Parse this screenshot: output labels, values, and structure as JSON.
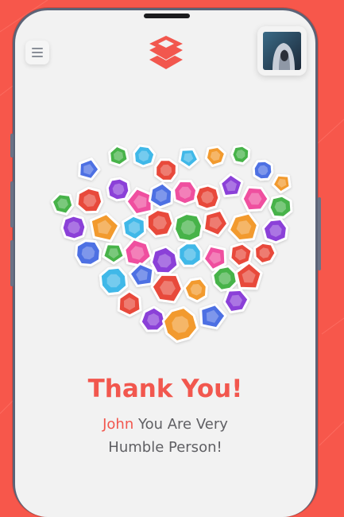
{
  "header": {
    "menu_icon": "hamburger-menu-icon",
    "logo_icon": "stacked-chevrons-logo",
    "avatar": "user-avatar-hooded-figure"
  },
  "illustration": {
    "name": "heart-of-gems"
  },
  "main": {
    "title": "Thank You!",
    "name": "John",
    "message_line1": " You Are Very",
    "message_line2": "Humble Person!"
  },
  "colors": {
    "accent": "#f2574e",
    "background": "#f7574b",
    "screen": "#f2f2f2",
    "text": "#5f5f63"
  }
}
